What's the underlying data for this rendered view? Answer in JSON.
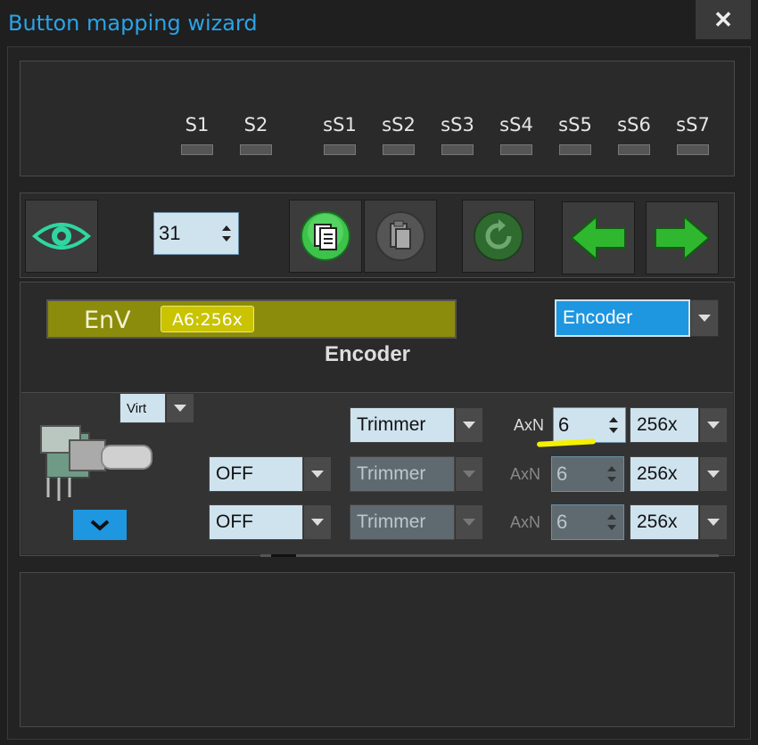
{
  "window": {
    "title": "Button mapping wizard",
    "close_label": "✕"
  },
  "slots": [
    {
      "label": "S1"
    },
    {
      "label": "S2"
    },
    {
      "label": "sS1"
    },
    {
      "label": "sS2"
    },
    {
      "label": "sS3"
    },
    {
      "label": "sS4"
    },
    {
      "label": "sS5"
    },
    {
      "label": "sS6"
    },
    {
      "label": "sS7"
    }
  ],
  "toolbar": {
    "page_value": "31"
  },
  "display": {
    "name": "EnV",
    "badge": "A6:256x"
  },
  "type_select": {
    "value": "Encoder"
  },
  "section_title": "Encoder",
  "virt_select": {
    "value": "Virt"
  },
  "rows": [
    {
      "mode": "",
      "mode_shown": false,
      "trimmer": "Trimmer",
      "axn_label": "AxN",
      "axn_value": "6",
      "scale": "256x",
      "enabled": true
    },
    {
      "mode": "OFF",
      "mode_shown": true,
      "trimmer": "Trimmer",
      "axn_label": "AxN",
      "axn_value": "6",
      "scale": "256x",
      "enabled": false
    },
    {
      "mode": "OFF",
      "mode_shown": true,
      "trimmer": "Trimmer",
      "axn_label": "AxN",
      "axn_value": "6",
      "scale": "256x",
      "enabled": false
    }
  ],
  "colors": {
    "accent": "#2aa3e8",
    "display_bg": "#8c8c0c",
    "badge": "#c9c300",
    "highlight": "#f5f000"
  }
}
